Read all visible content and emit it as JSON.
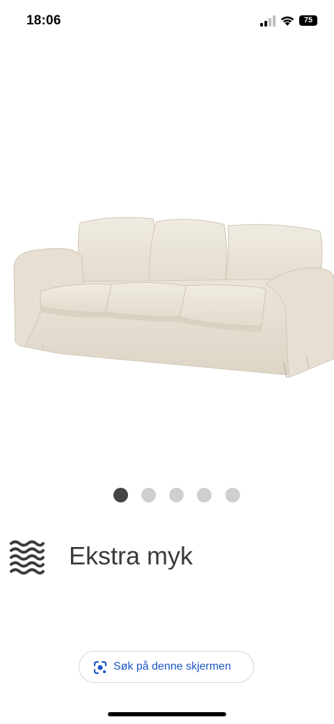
{
  "status_bar": {
    "time": "18:06",
    "battery_percent": "75",
    "signal_icon": "cellular-signal-icon",
    "wifi_icon": "wifi-icon"
  },
  "product": {
    "image": "beige-three-seat-sofa",
    "colors": {
      "fabric": "#e8e2d6",
      "shadow": "#cfc7b7"
    }
  },
  "carousel": {
    "page_count": 5,
    "active_index": 0
  },
  "feature": {
    "icon": "wave-softness-icon",
    "label": "Ekstra myk"
  },
  "lens_search": {
    "icon": "google-lens-icon",
    "label": "Søk på denne skjermen",
    "accent": "#1a56c4"
  }
}
